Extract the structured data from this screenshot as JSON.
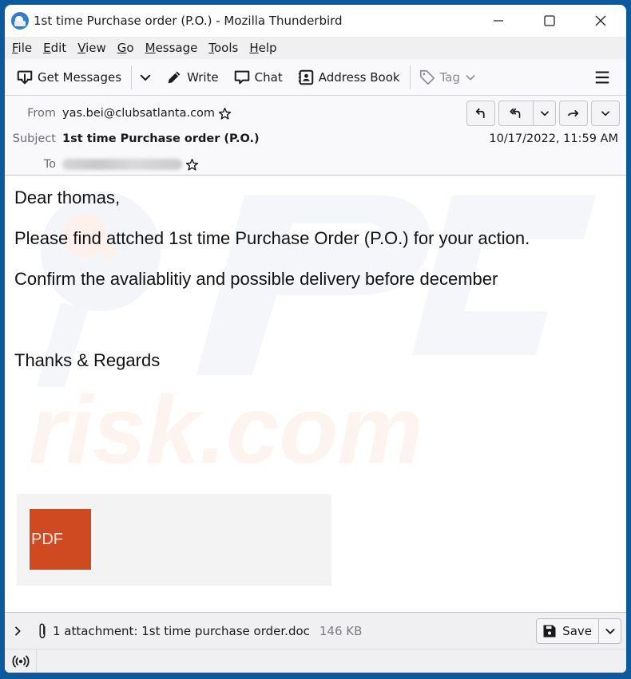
{
  "window": {
    "title": "1st time Purchase order (P.O.) - Mozilla Thunderbird",
    "controls": {
      "minimize": "minimize-icon",
      "maximize": "maximize-icon",
      "close": "close-icon"
    }
  },
  "menubar": {
    "items": [
      {
        "accel": "F",
        "rest": "ile"
      },
      {
        "accel": "E",
        "rest": "dit"
      },
      {
        "accel": "V",
        "rest": "iew"
      },
      {
        "accel": "G",
        "rest": "o"
      },
      {
        "accel": "M",
        "rest": "essage"
      },
      {
        "accel": "T",
        "rest": "ools"
      },
      {
        "accel": "H",
        "rest": "elp"
      }
    ]
  },
  "toolbar": {
    "get_messages": "Get Messages",
    "write": "Write",
    "chat": "Chat",
    "address_book": "Address Book",
    "tag": "Tag"
  },
  "header": {
    "from_label": "From",
    "from_value": "yas.bei@clubsatlanta.com",
    "subject_label": "Subject",
    "subject_value": "1st time Purchase order (P.O.)",
    "to_label": "To",
    "to_value_redacted": true,
    "date": "10/17/2022, 11:59 AM",
    "actions": [
      "reply",
      "reply-all",
      "reply-all-menu",
      "forward",
      "more"
    ]
  },
  "body": {
    "paragraphs": [
      "Dear  thomas,",
      "Please find attched 1st time Purchase Order (P.O.) for your action.",
      "Confirm the avaliablitiy and possible delivery before december",
      "",
      "Thanks & Regards"
    ],
    "attachment_tile_label": "PDF",
    "watermark_text": "risk.com"
  },
  "attachment_bar": {
    "summary": "1 attachment: 1st time purchase order.doc",
    "size": "146 KB",
    "save_label": "Save"
  },
  "colors": {
    "window_border": "#0b5aa0",
    "pdf_tile": "#d04a21",
    "toolbar_bg": "#f9f9fb",
    "menubar_bg": "#f0f0f0"
  }
}
